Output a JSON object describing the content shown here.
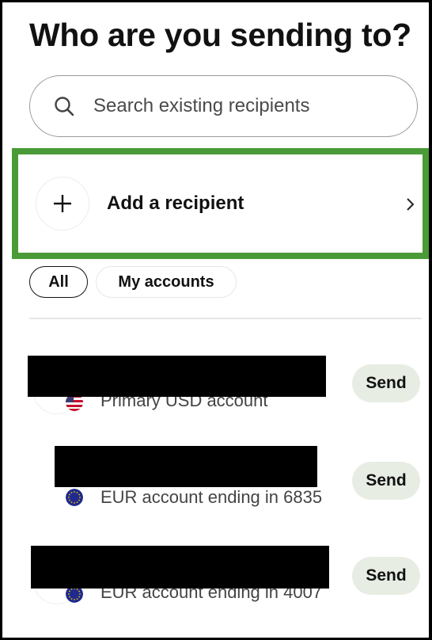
{
  "header": {
    "title": "Who are you sending to?"
  },
  "search": {
    "placeholder": "Search existing recipients"
  },
  "add_recipient": {
    "label": "Add a recipient"
  },
  "filters": [
    {
      "label": "All",
      "selected": true
    },
    {
      "label": "My accounts",
      "selected": false
    }
  ],
  "recipients": [
    {
      "name": "",
      "name_redacted": true,
      "account": "Primary USD account",
      "flag": "us-flag-icon",
      "send_label": "Send"
    },
    {
      "name": "",
      "name_redacted": true,
      "account": "EUR account ending in 6835",
      "flag": "eu-flag-icon",
      "send_label": "Send"
    },
    {
      "name": "",
      "name_redacted": true,
      "account": "EUR account ending in 4007",
      "flag": "eu-flag-icon",
      "send_label": "Send"
    }
  ],
  "colors": {
    "highlight_border": "#4a9b37",
    "send_button_bg": "#e8ede4",
    "redaction": "#000000",
    "eu_flag_blue": "#1f2a8c",
    "eu_flag_stars": "#f2c200"
  }
}
